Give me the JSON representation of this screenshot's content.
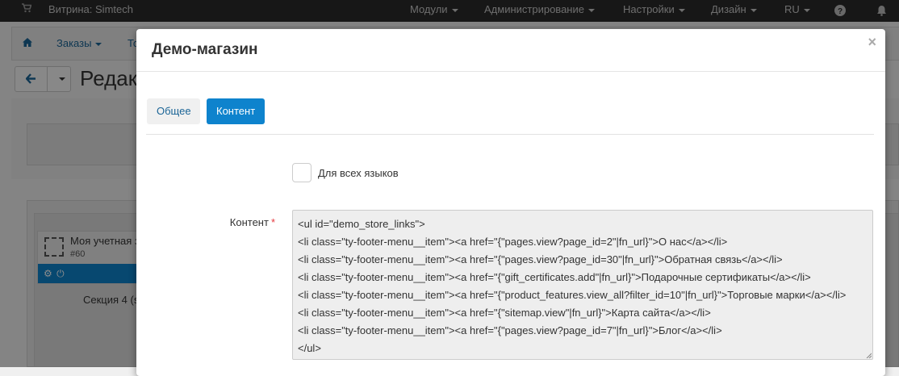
{
  "topbar": {
    "storefront": "Витрина: Simtech",
    "modules": "Модули",
    "administration": "Администрирование",
    "settings": "Настройки",
    "design": "Дизайн",
    "language": "RU"
  },
  "subnav": {
    "orders": "Заказы",
    "products_partial": "То"
  },
  "page": {
    "title_partial": "Редакт"
  },
  "background": {
    "block_name": "Моя учетная з",
    "block_num": "#60",
    "section_label": "Секция 4 (s"
  },
  "modal": {
    "title": "Демо-магазин",
    "close": "×",
    "tabs": {
      "general": "Общее",
      "content": "Контент"
    },
    "all_languages_label": "Для всех языков",
    "content_label": "Контент",
    "required_mark": "*",
    "content_lines": [
      "<ul id=\"demo_store_links\">",
      "<li class=\"ty-footer-menu__item\"><a href=\"{\"pages.view?page_id=2\"|fn_url}\">О нас</a></li>",
      "<li class=\"ty-footer-menu__item\"><a href=\"{\"pages.view?page_id=30\"|fn_url}\">Обратная связь</a></li>",
      "<li class=\"ty-footer-menu__item\"><a href=\"{\"gift_certificates.add\"|fn_url}\">Подарочные сертификаты</a></li>",
      "<li class=\"ty-footer-menu__item\"><a href=\"{\"product_features.view_all?filter_id=10\"|fn_url}\">Торговые марки</a></li>",
      "<li class=\"ty-footer-menu__item\"><a href=\"{\"sitemap.view\"|fn_url}\">Карта сайта</a></li>",
      "<li class=\"ty-footer-menu__item\"><a href=\"{\"pages.view?page_id=7\"|fn_url}\">Блог</a></li>",
      "</ul>"
    ]
  },
  "icons": {
    "cart": "cart-icon",
    "help": "question-circle-icon",
    "bell": "bell-icon",
    "home": "home-icon",
    "back": "arrow-left-icon",
    "gear": "gear-icon",
    "power": "power-icon"
  },
  "colors": {
    "primary": "#0e83cd",
    "topbar": "#2b2b2b",
    "required": "#e5393e"
  }
}
